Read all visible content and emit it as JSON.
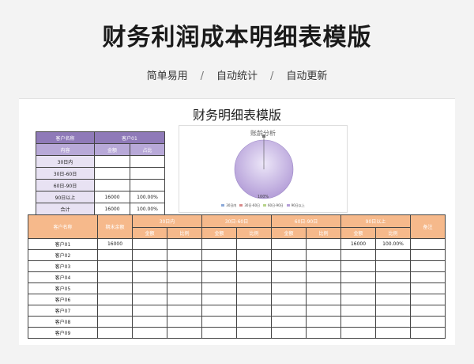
{
  "header": {
    "title": "财务利润成本明细表模版",
    "tags": [
      "简单易用",
      "自动统计",
      "自动更新"
    ],
    "separator": "/"
  },
  "sheet": {
    "title": "财务明细表模版",
    "summary": {
      "head": [
        "客户名称",
        "客户01"
      ],
      "sub": [
        "内容",
        "金额",
        "占比"
      ],
      "rows": [
        {
          "label": "30日内",
          "amount": "",
          "ratio": ""
        },
        {
          "label": "30日-60日",
          "amount": "",
          "ratio": ""
        },
        {
          "label": "60日-90日",
          "amount": "",
          "ratio": ""
        },
        {
          "label": "90日以上",
          "amount": "16000",
          "ratio": "100.00%"
        },
        {
          "label": "合计",
          "amount": "16000",
          "ratio": "100.00%"
        }
      ]
    },
    "chart_data": {
      "type": "pie",
      "title": "账龄分析",
      "categories": [
        "30日内",
        "30日-60日",
        "60日-90日",
        "90日以上"
      ],
      "values": [
        0,
        0,
        0,
        16000
      ],
      "colors": [
        "#8aa8d8",
        "#d98a8a",
        "#b7d48a",
        "#b49ed8"
      ],
      "data_label": "100%"
    },
    "detail": {
      "col_customer": "客户名称",
      "col_balance": "期末余额",
      "groups": [
        "30日内",
        "30日-60日",
        "60日-90日",
        "90日以上"
      ],
      "sub_amount": "金额",
      "sub_ratio": "比例",
      "col_note": "备注",
      "rows": [
        {
          "name": "客户01",
          "balance": "16000",
          "g4_amount": "16000",
          "g4_ratio": "100.00%"
        },
        {
          "name": "客户02",
          "balance": "",
          "g4_amount": "",
          "g4_ratio": ""
        },
        {
          "name": "客户03",
          "balance": "",
          "g4_amount": "",
          "g4_ratio": ""
        },
        {
          "name": "客户04",
          "balance": "",
          "g4_amount": "",
          "g4_ratio": ""
        },
        {
          "name": "客户05",
          "balance": "",
          "g4_amount": "",
          "g4_ratio": ""
        },
        {
          "name": "客户06",
          "balance": "",
          "g4_amount": "",
          "g4_ratio": ""
        },
        {
          "name": "客户07",
          "balance": "",
          "g4_amount": "",
          "g4_ratio": ""
        },
        {
          "name": "客户08",
          "balance": "",
          "g4_amount": "",
          "g4_ratio": ""
        },
        {
          "name": "客户09",
          "balance": "",
          "g4_amount": "",
          "g4_ratio": ""
        }
      ]
    }
  }
}
